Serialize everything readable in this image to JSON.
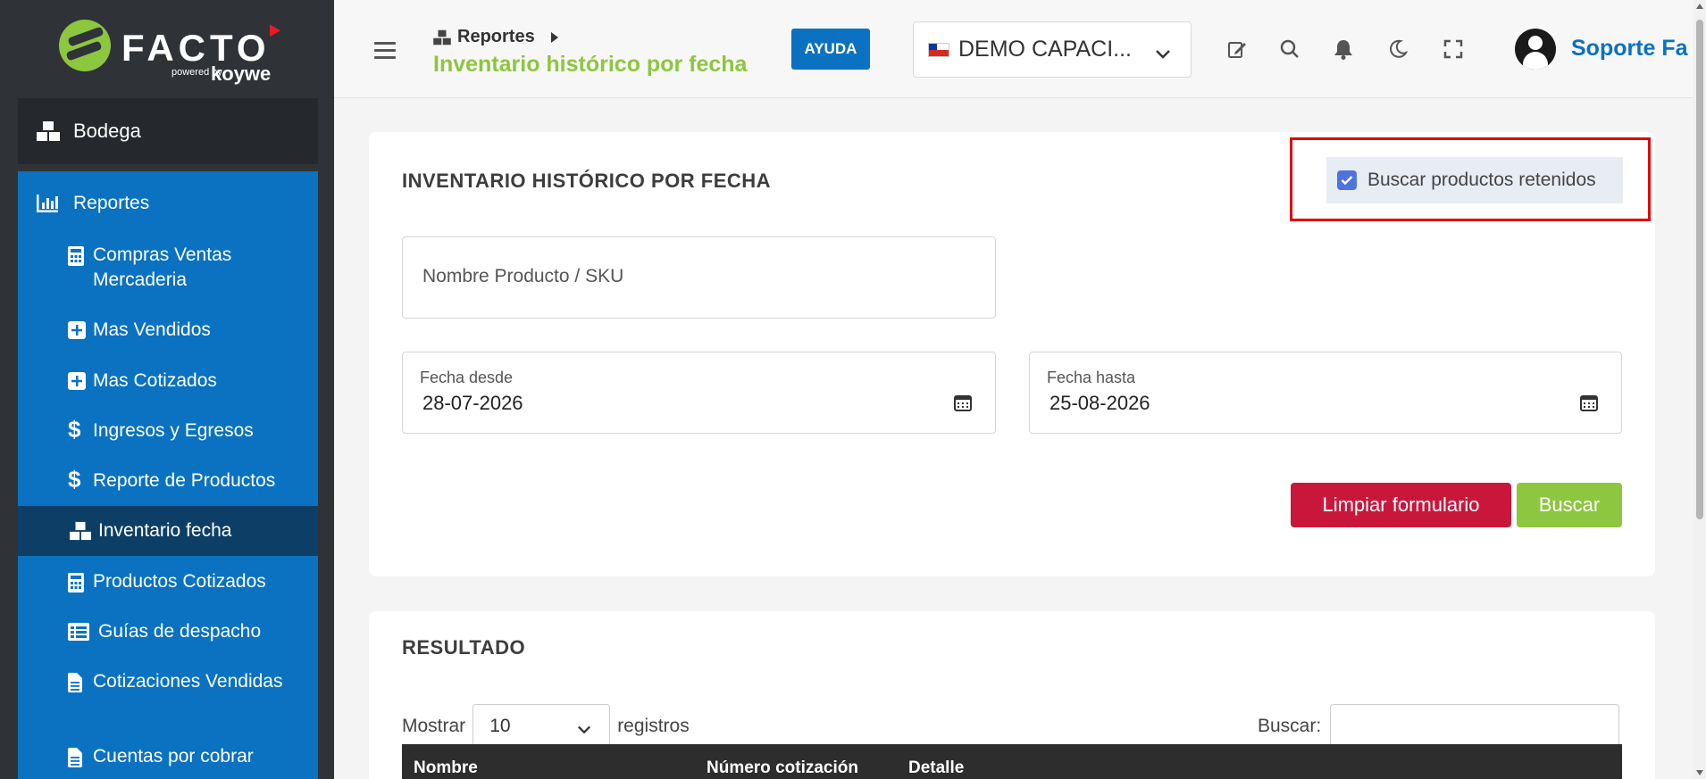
{
  "sidebar": {
    "logo": {
      "brand": "FACTO",
      "powered": "powered by",
      "partner": "koywe"
    },
    "store": "Bodega",
    "menu_header": "Reportes",
    "items": [
      {
        "label": "Compras Ventas Mercaderia",
        "icon": "calculator-icon"
      },
      {
        "label": "Mas Vendidos",
        "icon": "plus-square-icon"
      },
      {
        "label": "Mas Cotizados",
        "icon": "plus-square-icon"
      },
      {
        "label": "Ingresos y Egresos",
        "icon": "dollar-icon"
      },
      {
        "label": "Reporte de Productos",
        "icon": "dollar-icon"
      },
      {
        "label": "Inventario fecha",
        "icon": "boxes-icon",
        "active": true
      },
      {
        "label": "Productos Cotizados",
        "icon": "calculator-icon"
      },
      {
        "label": "Guías de despacho",
        "icon": "list-icon"
      },
      {
        "label": "Cotizaciones Vendidas",
        "icon": "file-icon"
      },
      {
        "label": "Cuentas por cobrar",
        "icon": "file-icon"
      }
    ]
  },
  "header": {
    "breadcrumb": "Reportes",
    "page_title": "Inventario histórico por fecha",
    "help_button": "AYUDA",
    "company": "DEMO CAPACI...",
    "user": "Soporte Fa"
  },
  "form": {
    "title": "INVENTARIO HISTÓRICO POR FECHA",
    "retained_checkbox_label": "Buscar productos retenidos",
    "retained_checked": true,
    "product_placeholder": "Nombre Producto / SKU",
    "date_from_label": "Fecha desde",
    "date_from": "28-07-2026",
    "date_to_label": "Fecha hasta",
    "date_to": "25-08-2026",
    "clear_button": "Limpiar formulario",
    "search_button": "Buscar"
  },
  "results": {
    "title": "RESULTADO",
    "show_label": "Mostrar",
    "page_size": "10",
    "records_label": "registros",
    "search_label": "Buscar:",
    "columns": [
      "Nombre",
      "Número cotización",
      "Detalle"
    ]
  },
  "colors": {
    "sidebar_bg": "#2f3237",
    "menu_blue": "#0a72c0",
    "active_item": "#0d3f66",
    "accent_green": "#8dc63f",
    "danger_red": "#c9173c",
    "highlight": "#e00000"
  }
}
